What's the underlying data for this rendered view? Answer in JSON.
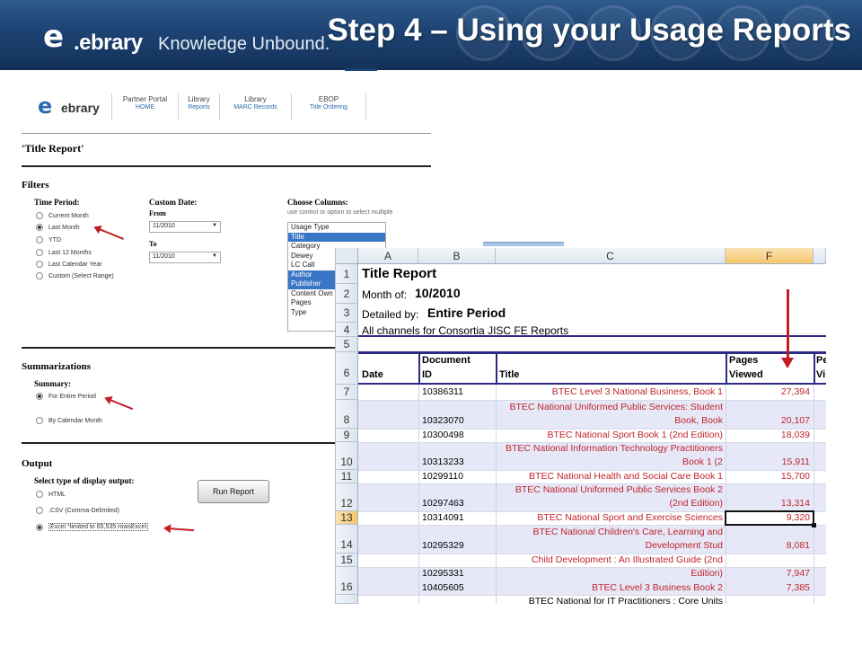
{
  "banner": {
    "logo_letter": "e",
    "logo_word": ".ebrary",
    "tagline": "Knowledge Unbound.",
    "title": "Step 4 – Using your Usage Reports"
  },
  "web": {
    "logo_letter": "e",
    "logo_word": "ebrary",
    "nav": [
      {
        "line1": "Partner Portal",
        "line2": "HOME"
      },
      {
        "line1": "Library",
        "line2": "Reports"
      },
      {
        "line1": "Library",
        "line2": "MARC Records"
      },
      {
        "line1": "EBOP",
        "line2": "Title Ordering"
      }
    ],
    "report_title": "'Title Report'",
    "filters": {
      "heading": "Filters",
      "time_period_label": "Time Period:",
      "time_options": [
        "Current Month",
        "Last Month",
        "YTD",
        "Last 12 Months",
        "Last Calendar Year",
        "Custom (Select Range)"
      ],
      "selected_time": "Last Month",
      "custom_date_label": "Custom Date:",
      "from_label": "From",
      "from_value": "11/2010",
      "to_label": "To",
      "to_value": "11/2010",
      "choose_columns_label": "Choose Columns:",
      "choose_columns_hint": "use control or option to select multiple",
      "columns": [
        {
          "name": "Usage Type",
          "selected": false
        },
        {
          "name": "Title",
          "selected": true
        },
        {
          "name": "Category",
          "selected": false
        },
        {
          "name": "Dewey",
          "selected": false
        },
        {
          "name": "LC Call",
          "selected": false
        },
        {
          "name": "Author",
          "selected": true
        },
        {
          "name": "Publisher",
          "selected": true
        },
        {
          "name": "Content Own",
          "selected": false
        },
        {
          "name": "Pages",
          "selected": false
        },
        {
          "name": "Type",
          "selected": false
        }
      ]
    },
    "summarizations": {
      "heading": "Summarizations",
      "summary_label": "Summary:",
      "options": [
        "For Entire Period",
        "By Calendar Month"
      ],
      "selected": "For Entire Period"
    },
    "output": {
      "heading": "Output",
      "select_label": "Select type of display output:",
      "options": [
        "HTML",
        ".CSV (Comma-Delimited)",
        "Excel *limited to 65,535 rowsExcel"
      ],
      "selected": "Excel *limited to 65,535 rowsExcel",
      "run_button": "Run Report"
    }
  },
  "excel": {
    "columns": [
      "A",
      "B",
      "C",
      "F"
    ],
    "active_column": "F",
    "active_row": "13",
    "row_numbers": [
      "1",
      "2",
      "3",
      "4",
      "5",
      "6",
      "7",
      "8",
      "9",
      "10",
      "11",
      "12",
      "13",
      "14",
      "15",
      "16"
    ],
    "title": "Title Report",
    "month_label": "Month of:",
    "month_value": "10/2010",
    "detailed_label": "Detailed by:",
    "detailed_value": "Entire Period",
    "channels": "All channels for Consortia JISC FE Reports",
    "headers": {
      "date": "Date",
      "doc_id_1": "Document",
      "doc_id_2": "ID",
      "title": "Title",
      "pages_1": "Pages",
      "pages_2": "Viewed",
      "next_1": "Pe",
      "next_2": "Vi"
    },
    "rows": [
      {
        "id": "10386311",
        "t1": "",
        "t2": "BTEC Level 3 National Business, Book 1",
        "pages": "27,394"
      },
      {
        "id": "10323070",
        "t1": "BTEC National Uniformed Public Services: Student",
        "t2": "Book, Book",
        "pages": "20,107"
      },
      {
        "id": "10300498",
        "t1": "",
        "t2": "BTEC National Sport Book 1 (2nd Edition)",
        "pages": "18,039"
      },
      {
        "id": "10313233",
        "t1": "BTEC National Information Technology Practitioners",
        "t2": "Book 1 (2",
        "pages": "15,911"
      },
      {
        "id": "10299110",
        "t1": "",
        "t2": "BTEC National Health and Social Care Book 1",
        "pages": "15,700"
      },
      {
        "id": "10297463",
        "t1": "BTEC National Uniformed Public Services Book 2",
        "t2": "(2nd Edition)",
        "pages": "13,314"
      },
      {
        "id": "10314091",
        "t1": "",
        "t2": "BTEC National Sport and Exercise Sciences",
        "pages": "9,320"
      },
      {
        "id": "10295329",
        "t1": "BTEC National Children's Care, Learning and",
        "t2": "Development Stud",
        "pages": "8,081"
      },
      {
        "id": "10295331",
        "t1": "Child Development : An Illustrated Guide (2nd",
        "t2": "Edition)",
        "pages": "7,947"
      },
      {
        "id": "10405605",
        "t1": "",
        "t2": "BTEC Level 3 Business Book 2",
        "pages": "7,385"
      }
    ],
    "partial_title": "BTEC National for IT Practitioners : Core Units"
  }
}
